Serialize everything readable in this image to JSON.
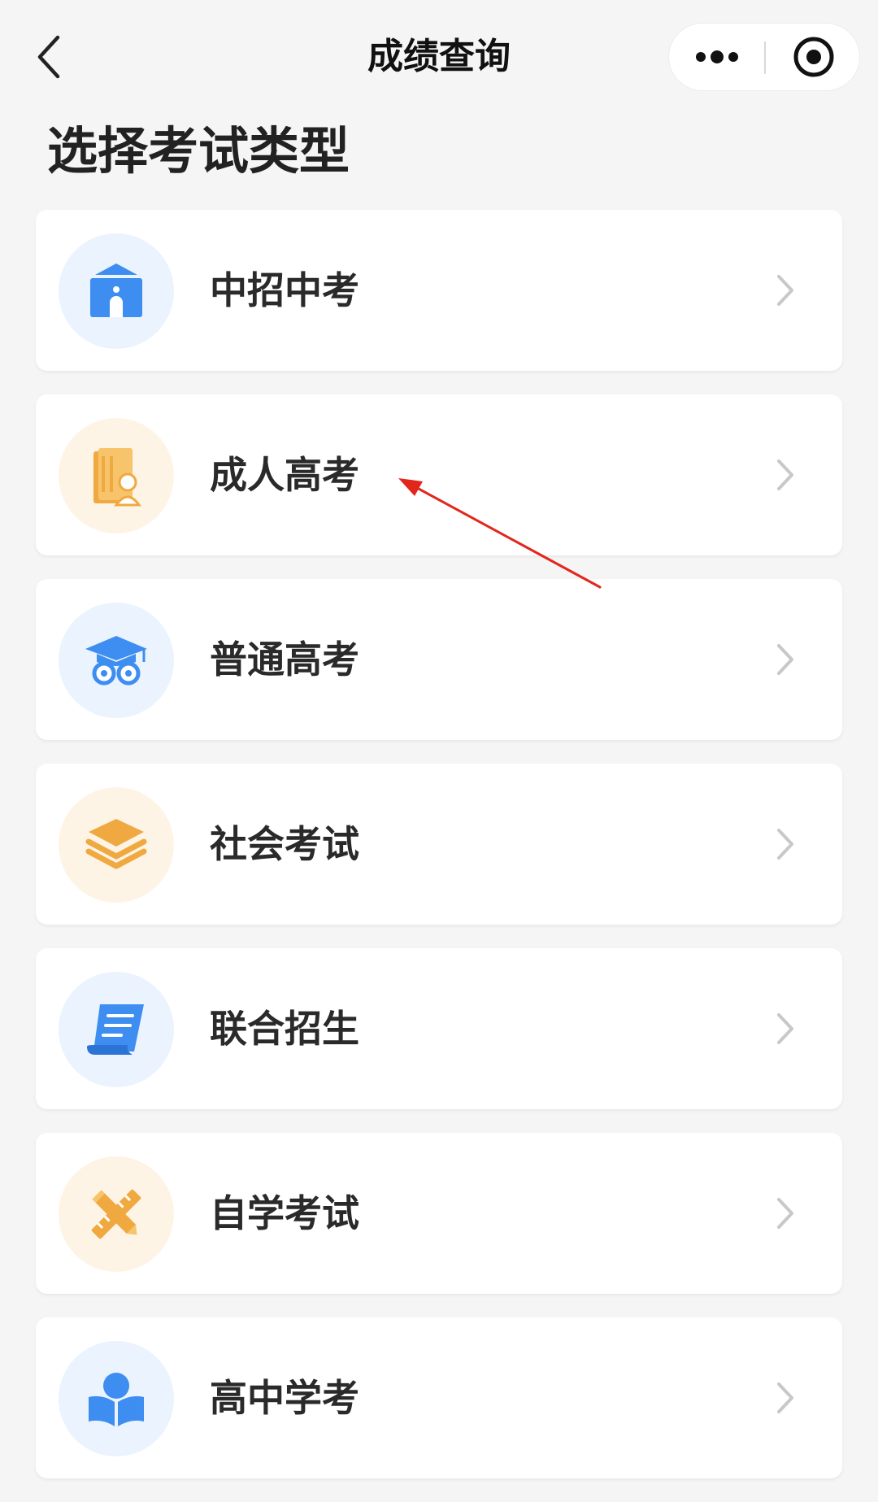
{
  "nav": {
    "title": "成绩查询",
    "back_icon": "chevron-left-icon",
    "more_icon": "more-dots-icon",
    "close_icon": "target-close-icon"
  },
  "heading": "选择考试类型",
  "exams": [
    {
      "label": "中招中考",
      "icon": "school-building-icon",
      "color": "#3d8ef0"
    },
    {
      "label": "成人高考",
      "icon": "book-person-icon",
      "color": "#f0a940"
    },
    {
      "label": "普通高考",
      "icon": "graduation-cap-owl-icon",
      "color": "#3d8ef0"
    },
    {
      "label": "社会考试",
      "icon": "layers-stack-icon",
      "color": "#f0a940"
    },
    {
      "label": "联合招生",
      "icon": "scroll-document-icon",
      "color": "#3d8ef0"
    },
    {
      "label": "自学考试",
      "icon": "pencil-ruler-icon",
      "color": "#f0a940"
    },
    {
      "label": "高中学考",
      "icon": "open-book-reader-icon",
      "color": "#3d8ef0"
    }
  ],
  "colors": {
    "accent_blue": "#3d8ef0",
    "accent_orange": "#f0a940",
    "annotation_red": "#e3261c"
  }
}
